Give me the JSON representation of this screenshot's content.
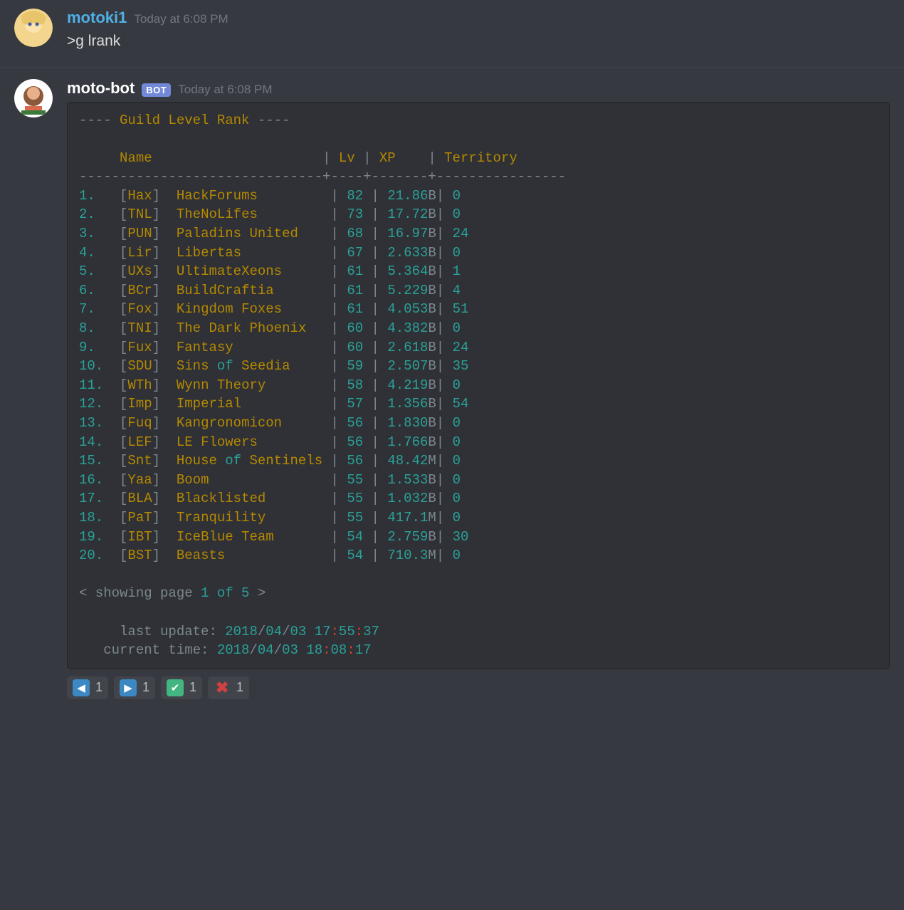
{
  "messages": [
    {
      "username": "motoki1",
      "timestamp": "Today at 6:08 PM",
      "text": ">g lrank"
    },
    {
      "username": "moto-bot",
      "bot": "BOT",
      "timestamp": "Today at 6:08 PM"
    }
  ],
  "codeblock": {
    "title": "Guild Level Rank",
    "headers": {
      "name": "Name",
      "lv": "Lv",
      "xp": "XP",
      "territory": "Territory"
    },
    "rows": [
      {
        "rank": "1.",
        "tag": "Hax",
        "name": "HackForums",
        "lv": "82",
        "xp_num": "21.86",
        "xp_suf": "B",
        "terr": "0"
      },
      {
        "rank": "2.",
        "tag": "TNL",
        "name": "TheNoLifes",
        "lv": "73",
        "xp_num": "17.72",
        "xp_suf": "B",
        "terr": "0"
      },
      {
        "rank": "3.",
        "tag": "PUN",
        "name": "Paladins United",
        "lv": "68",
        "xp_num": "16.97",
        "xp_suf": "B",
        "terr": "24"
      },
      {
        "rank": "4.",
        "tag": "Lir",
        "name": "Libertas",
        "lv": "67",
        "xp_num": "2.633",
        "xp_suf": "B",
        "terr": "0"
      },
      {
        "rank": "5.",
        "tag": "UXs",
        "name": "UltimateXeons",
        "lv": "61",
        "xp_num": "5.364",
        "xp_suf": "B",
        "terr": "1"
      },
      {
        "rank": "6.",
        "tag": "BCr",
        "name": "BuildCraftia",
        "lv": "61",
        "xp_num": "5.229",
        "xp_suf": "B",
        "terr": "4"
      },
      {
        "rank": "7.",
        "tag": "Fox",
        "name": "Kingdom Foxes",
        "lv": "61",
        "xp_num": "4.053",
        "xp_suf": "B",
        "terr": "51"
      },
      {
        "rank": "8.",
        "tag": "TNI",
        "name": "The Dark Phoenix",
        "lv": "60",
        "xp_num": "4.382",
        "xp_suf": "B",
        "terr": "0"
      },
      {
        "rank": "9.",
        "tag": "Fux",
        "name": "Fantasy",
        "lv": "60",
        "xp_num": "2.618",
        "xp_suf": "B",
        "terr": "24"
      },
      {
        "rank": "10.",
        "tag": "SDU",
        "name_parts": [
          "Sins ",
          "of",
          " Seedia"
        ],
        "lv": "59",
        "xp_num": "2.507",
        "xp_suf": "B",
        "terr": "35"
      },
      {
        "rank": "11.",
        "tag": "WTh",
        "name": "Wynn Theory",
        "lv": "58",
        "xp_num": "4.219",
        "xp_suf": "B",
        "terr": "0"
      },
      {
        "rank": "12.",
        "tag": "Imp",
        "name": "Imperial",
        "lv": "57",
        "xp_num": "1.356",
        "xp_suf": "B",
        "terr": "54"
      },
      {
        "rank": "13.",
        "tag": "Fuq",
        "name": "Kangronomicon",
        "lv": "56",
        "xp_num": "1.830",
        "xp_suf": "B",
        "terr": "0"
      },
      {
        "rank": "14.",
        "tag": "LEF",
        "name": "LE Flowers",
        "lv": "56",
        "xp_num": "1.766",
        "xp_suf": "B",
        "terr": "0"
      },
      {
        "rank": "15.",
        "tag": "Snt",
        "name_parts": [
          "House ",
          "of",
          " Sentinels"
        ],
        "lv": "56",
        "xp_num": "48.42",
        "xp_suf": "M",
        "terr": "0"
      },
      {
        "rank": "16.",
        "tag": "Yaa",
        "name": "Boom",
        "lv": "55",
        "xp_num": "1.533",
        "xp_suf": "B",
        "terr": "0"
      },
      {
        "rank": "17.",
        "tag": "BLA",
        "name": "Blacklisted",
        "lv": "55",
        "xp_num": "1.032",
        "xp_suf": "B",
        "terr": "0"
      },
      {
        "rank": "18.",
        "tag": "PaT",
        "name": "Tranquility",
        "lv": "55",
        "xp_num": "417.1",
        "xp_suf": "M",
        "terr": "0"
      },
      {
        "rank": "19.",
        "tag": "IBT",
        "name": "IceBlue Team",
        "lv": "54",
        "xp_num": "2.759",
        "xp_suf": "B",
        "terr": "30"
      },
      {
        "rank": "20.",
        "tag": "BST",
        "name": "Beasts",
        "lv": "54",
        "xp_num": "710.3",
        "xp_suf": "M",
        "terr": "0"
      }
    ],
    "pager": {
      "prefix": "< showing page ",
      "page": "1",
      "of": " of ",
      "total": "5",
      "suffix": " >"
    },
    "footer": {
      "last_update_label": "last update: ",
      "current_time_label": "current time: ",
      "last_update": {
        "y": "2018",
        "mo": "04",
        "d": "03",
        "h": "17",
        "mi": "55",
        "s": "37"
      },
      "current_time": {
        "y": "2018",
        "mo": "04",
        "d": "03",
        "h": "18",
        "mi": "08",
        "s": "17"
      }
    }
  },
  "reactions": [
    {
      "icon": "arrow-left-icon",
      "count": "1"
    },
    {
      "icon": "arrow-right-icon",
      "count": "1"
    },
    {
      "icon": "check-icon",
      "count": "1"
    },
    {
      "icon": "x-icon",
      "count": "1"
    }
  ]
}
